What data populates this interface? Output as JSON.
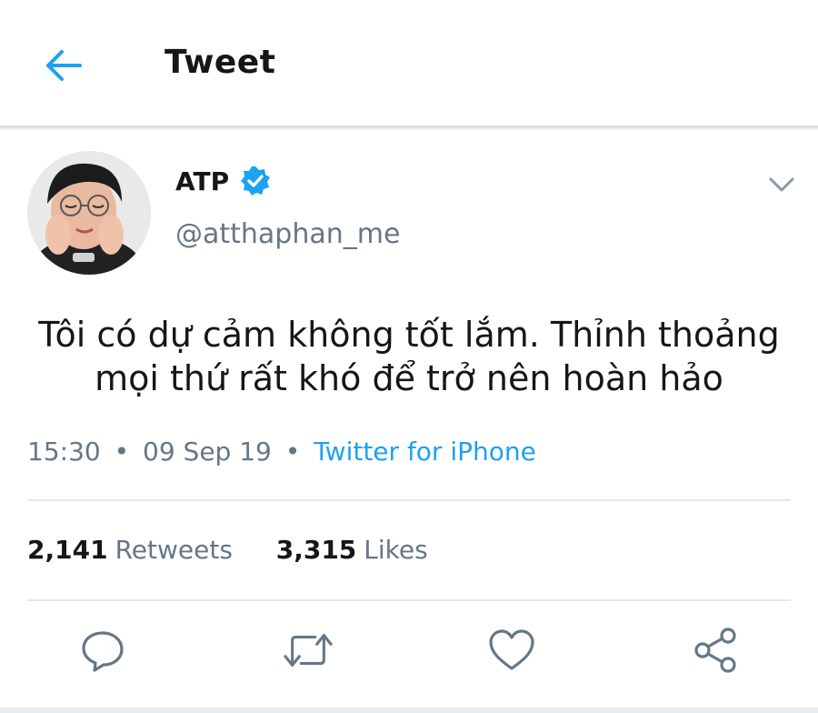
{
  "header": {
    "title": "Tweet"
  },
  "tweet": {
    "author": {
      "name": "ATP",
      "handle": "@atthaphan_me",
      "verified": true
    },
    "text": "Tôi có dự cảm không tốt lắm. Thỉnh thoảng mọi thứ rất khó để trở nên hoàn hảo",
    "time": "15:30",
    "separator": "•",
    "date": "09 Sep 19",
    "source": "Twitter for iPhone",
    "retweets": {
      "count": "2,141",
      "label": "Retweets"
    },
    "likes": {
      "count": "3,315",
      "label": "Likes"
    }
  },
  "icons": {
    "back": "arrow-left-icon",
    "verified": "verified-badge-icon",
    "more": "chevron-down-icon",
    "reply": "reply-icon",
    "retweet": "retweet-icon",
    "like": "heart-icon",
    "share": "share-icon"
  },
  "colors": {
    "accent": "#1da1f2",
    "text": "#14171a",
    "secondary": "#657786",
    "divider": "#e1e8ed",
    "icon": "#657786"
  }
}
